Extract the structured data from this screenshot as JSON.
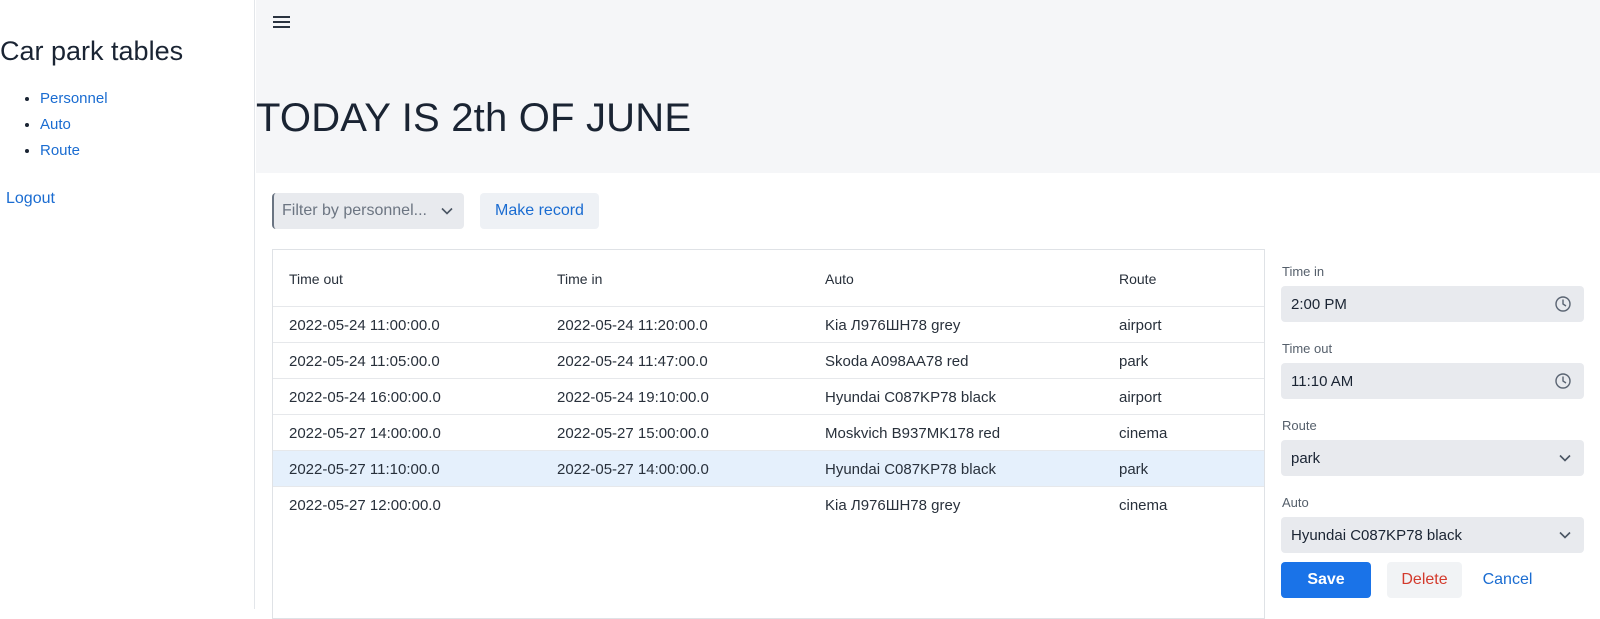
{
  "sidebar": {
    "title": "Car park tables",
    "items": [
      {
        "label": "Personnel"
      },
      {
        "label": "Auto"
      },
      {
        "label": "Route"
      }
    ],
    "logout": "Logout"
  },
  "header": {
    "menu_icon": "hamburger-menu-icon",
    "title": "TODAY IS 2th OF JUNE"
  },
  "toolbar": {
    "filter_placeholder": "Filter by personnel...",
    "make_record_label": "Make record"
  },
  "grid": {
    "columns": [
      "Time out",
      "Time in",
      "Auto",
      "Route"
    ],
    "rows": [
      {
        "time_out": "2022-05-24 11:00:00.0",
        "time_in": "2022-05-24 11:20:00.0",
        "auto": "Kia Л976ШН78 grey",
        "route": "airport"
      },
      {
        "time_out": "2022-05-24 11:05:00.0",
        "time_in": "2022-05-24 11:47:00.0",
        "auto": "Skoda A098AA78 red",
        "route": "park"
      },
      {
        "time_out": "2022-05-24 16:00:00.0",
        "time_in": "2022-05-24 19:10:00.0",
        "auto": "Hyundai C087KP78 black",
        "route": "airport"
      },
      {
        "time_out": "2022-05-27 14:00:00.0",
        "time_in": "2022-05-27 15:00:00.0",
        "auto": "Moskvich B937MK178 red",
        "route": "cinema"
      },
      {
        "time_out": "2022-05-27 11:10:00.0",
        "time_in": "2022-05-27 14:00:00.0",
        "auto": "Hyundai C087KP78 black",
        "route": "park"
      },
      {
        "time_out": "2022-05-27 12:00:00.0",
        "time_in": "",
        "auto": "Kia Л976ШН78 grey",
        "route": "cinema"
      }
    ],
    "selected_row": 4
  },
  "form": {
    "time_in_label": "Time in",
    "time_in_value": "2:00 PM",
    "time_out_label": "Time out",
    "time_out_value": "11:10 AM",
    "route_label": "Route",
    "route_value": "park",
    "auto_label": "Auto",
    "auto_value": "Hyundai C087KP78 black",
    "save_label": "Save",
    "delete_label": "Delete",
    "cancel_label": "Cancel"
  },
  "colors": {
    "accent": "#1a73e8",
    "link": "#1a6cd1",
    "danger": "#d33a2c",
    "selected_row": "#e5f0fc"
  }
}
